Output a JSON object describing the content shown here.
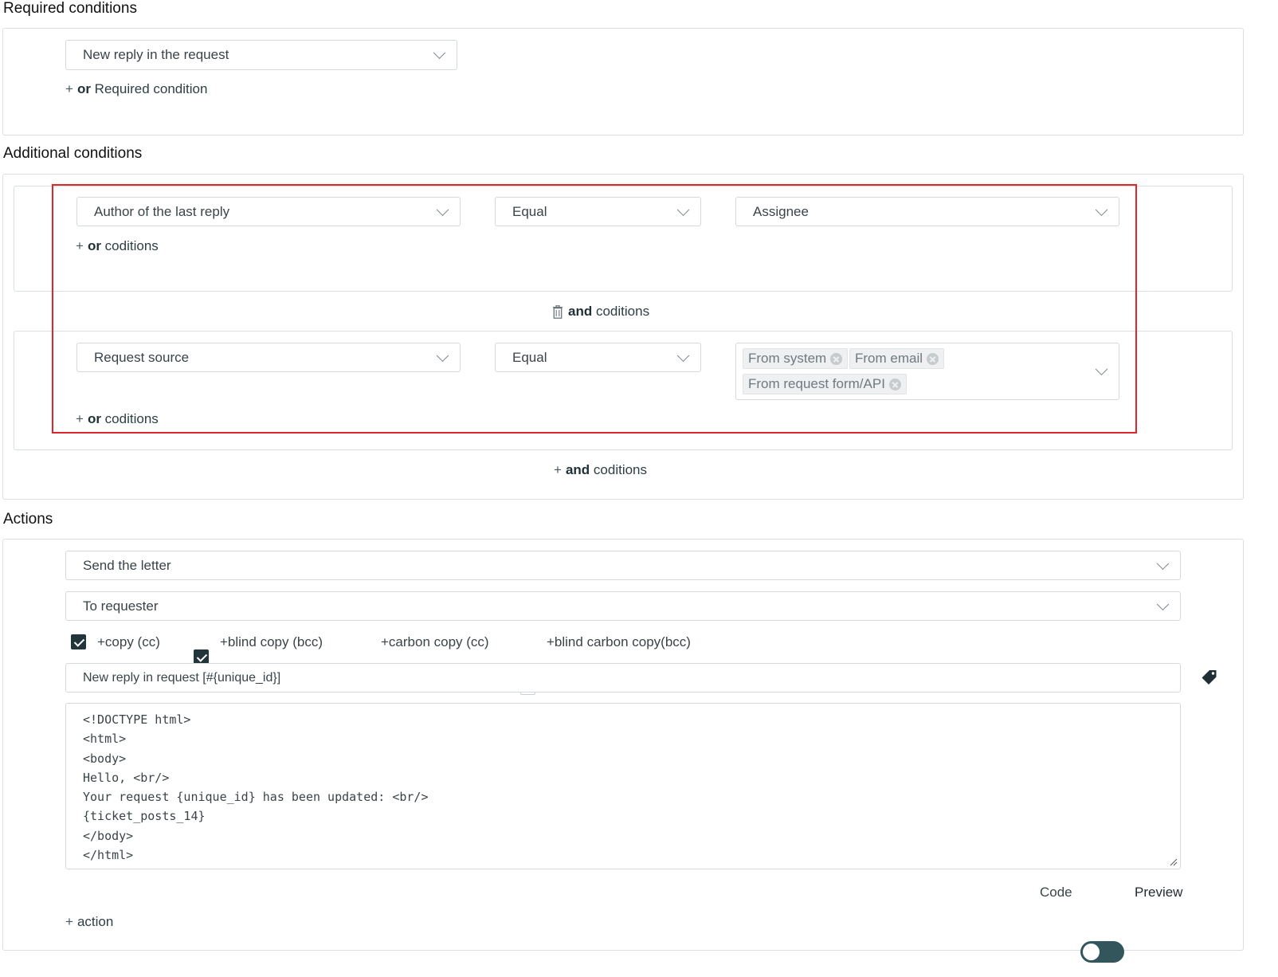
{
  "required": {
    "title": "Required conditions",
    "condition_value": "New reply in the request",
    "or_plus": "+",
    "or_word": "or",
    "or_text": "Required condition"
  },
  "additional": {
    "title": "Additional conditions",
    "group1": {
      "field": "Author of the last reply",
      "operator": "Equal",
      "value": "Assignee",
      "or_plus": "+",
      "or_word": "or",
      "or_text": "coditions"
    },
    "and_divider": {
      "and_word": "and",
      "text": "coditions"
    },
    "group2": {
      "field": "Request source",
      "operator": "Equal",
      "tags": [
        "From system",
        "From email",
        "From request form/API"
      ],
      "or_plus": "+",
      "or_word": "or",
      "or_text": "coditions"
    },
    "add_and": {
      "plus": "+",
      "and_word": "and",
      "text": "coditions"
    }
  },
  "actions": {
    "title": "Actions",
    "action_type": "Send the letter",
    "recipient": "To requester",
    "checkboxes": [
      {
        "label": "+copy (cc)",
        "checked": true
      },
      {
        "label": "+blind copy (bcc)",
        "checked": true
      },
      {
        "label": "+carbon copy (cc)",
        "checked": false
      },
      {
        "label": "+blind carbon copy(bcc)",
        "checked": false
      }
    ],
    "subject": "New reply in request [#{unique_id}]",
    "body": "<!DOCTYPE html>\n<html>\n<body>\nHello, <br/>\nYour request {unique_id} has been updated: <br/>\n{ticket_posts_14}\n</body>\n</html>",
    "toggle_left": "Code",
    "toggle_right": "Preview",
    "add_action_plus": "+",
    "add_action": "action"
  },
  "colors": {
    "highlight": "#e0262d",
    "accent": "#22353b",
    "toggle": "#33565d"
  }
}
